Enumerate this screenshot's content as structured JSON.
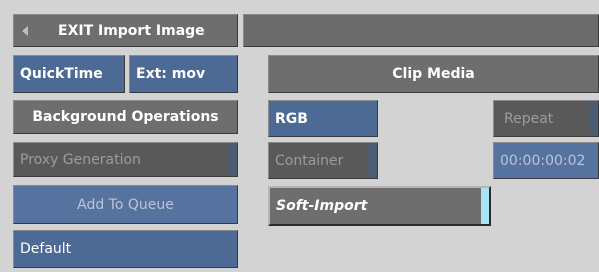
{
  "exit_button": {
    "label": "EXIT Import Image"
  },
  "format_button": {
    "label": "QuickTime"
  },
  "ext_field": {
    "label": "Ext: mov"
  },
  "background_ops": {
    "label": "Background Operations"
  },
  "proxy_generation": {
    "label": "Proxy Generation"
  },
  "add_to_queue": {
    "label": "Add To Queue"
  },
  "default_button": {
    "label": "Default"
  },
  "clip_media": {
    "label": "Clip Media"
  },
  "rgb_button": {
    "label": "RGB"
  },
  "container_button": {
    "label": "Container"
  },
  "soft_import": {
    "label": "Soft-Import"
  },
  "repeat_button": {
    "label": "Repeat"
  },
  "timecode": {
    "value": "00:00:00:02"
  },
  "colors": {
    "panel_bg": "#d3d3d3",
    "button_gray": "#6e6e6e",
    "button_blue": "#4d6a94",
    "toggle_on": "#a7e6f7"
  }
}
